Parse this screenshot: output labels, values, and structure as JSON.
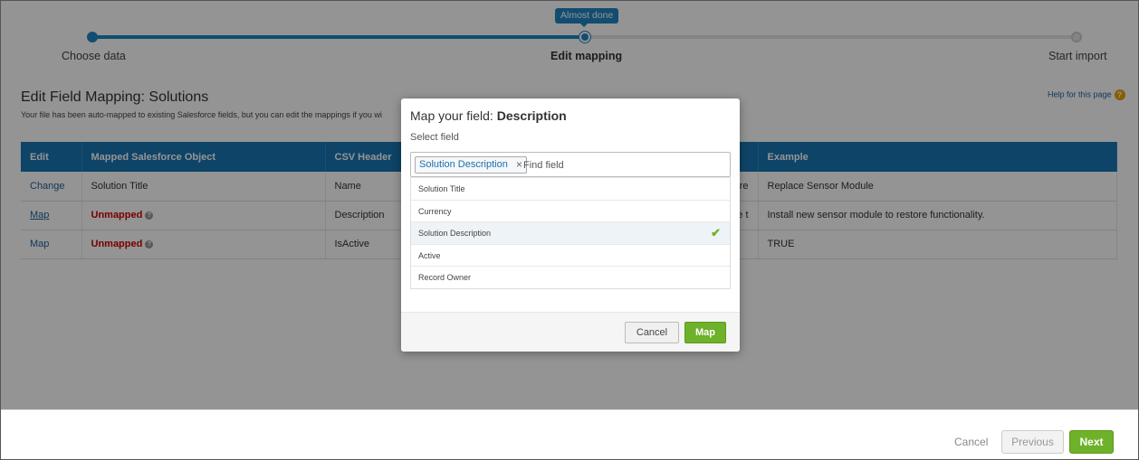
{
  "wizard": {
    "tooltip": "Almost done",
    "steps": [
      {
        "label": "Choose data",
        "state": "done"
      },
      {
        "label": "Edit mapping",
        "state": "current"
      },
      {
        "label": "Start import",
        "state": "todo"
      }
    ]
  },
  "page": {
    "title": "Edit Field Mapping: Solutions",
    "subtitle": "Your file has been auto-mapped to existing Salesforce fields, but you can edit the mappings if you wi",
    "help_link": "Help for this page",
    "help_icon_glyph": "?"
  },
  "table": {
    "headers": [
      "Edit",
      "Mapped Salesforce Object",
      "CSV Header",
      "",
      "Example"
    ],
    "rows": [
      {
        "edit": "Change",
        "mapped": "Solution Title",
        "unmapped": false,
        "csv": "Name",
        "extra": "re",
        "example": "Replace Sensor Module"
      },
      {
        "edit": "Map",
        "mapped": "Unmapped",
        "unmapped": true,
        "csv": "Description",
        "extra": "e t",
        "example": "Install new sensor module to restore functionality."
      },
      {
        "edit": "Map",
        "mapped": "Unmapped",
        "unmapped": true,
        "csv": "IsActive",
        "extra": "",
        "example": "TRUE"
      }
    ]
  },
  "modal": {
    "title_prefix": "Map your field: ",
    "title_field": "Description",
    "select_label": "Select field",
    "chip": "Solution Description",
    "chip_remove": "×",
    "find_placeholder": "Find field",
    "options": [
      {
        "label": "Solution Title",
        "selected": false
      },
      {
        "label": "Currency",
        "selected": false
      },
      {
        "label": "Solution Description",
        "selected": true
      },
      {
        "label": "Active",
        "selected": false
      },
      {
        "label": "Record Owner",
        "selected": false
      }
    ],
    "check_glyph": "✔",
    "cancel": "Cancel",
    "map": "Map"
  },
  "footer": {
    "cancel": "Cancel",
    "previous": "Previous",
    "next": "Next"
  },
  "colors": {
    "accent": "#1f86c3",
    "table_header": "#1976b2",
    "green": "#6eb12a",
    "unmapped": "#cc0000"
  }
}
